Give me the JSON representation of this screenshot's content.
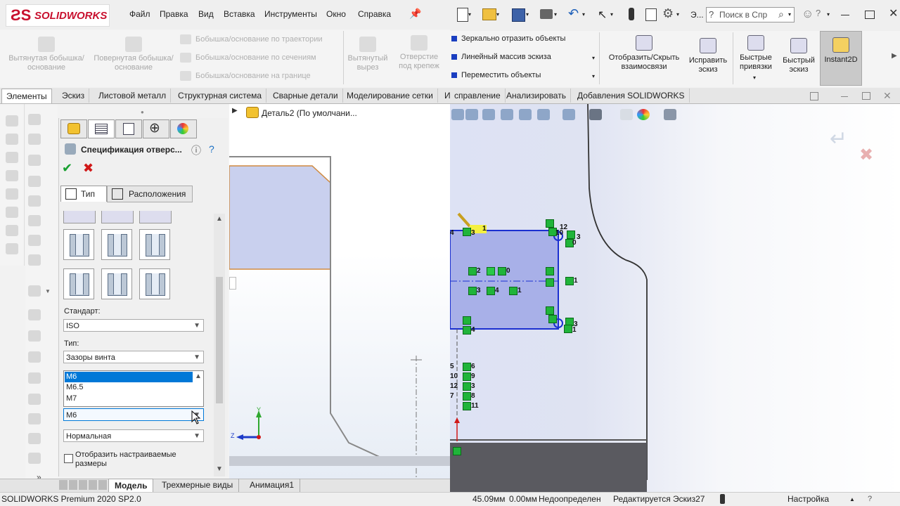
{
  "left": {
    "logo": "SOLIDWORKS",
    "menu": [
      "Файл",
      "Правка",
      "Вид",
      "Вставка",
      "Инструменты",
      "Окно",
      "Справка"
    ],
    "ribbon": {
      "extrude": "Вытянутая бобышка/основание",
      "revolve": "Повернутая бобышка/основание",
      "sweep": "Бобышка/основание по траектории",
      "loft": "Бобышка/основание по сечениям",
      "boundary": "Бобышка/основание на границе",
      "cut": "Вытянутый вырез",
      "hole": "Отверстие под крепеж"
    },
    "tabs": [
      "Элементы",
      "Эскиз",
      "Листовой металл",
      "Структурная система",
      "Сварные детали",
      "Моделирование сетки"
    ],
    "tab_partial": "Ис",
    "tree_item": "Деталь2  (По умолчани...",
    "pm": {
      "title": "Спецификация отверс...",
      "tab_type": "Тип",
      "tab_positions": "Расположения",
      "standard_label": "Стандарт:",
      "standard_value": "ISO",
      "type_label": "Тип:",
      "type_value": "Зазоры винта",
      "size_options": [
        "M6",
        "M6.5",
        "M7"
      ],
      "size_value": "M6",
      "fit_value": "Нормальная",
      "custom_sizes": "Отобразить настраиваемые размеры"
    },
    "bottom_tabs": [
      "Модель",
      "Трехмерные виды",
      "Анимация1"
    ],
    "status_version": "SOLIDWORKS Premium 2020 SP2.0",
    "triad_y": "Y",
    "triad_z": "Z"
  },
  "right": {
    "search_placeholder": "Поиск в Спр",
    "toolbar_partial": "Э...",
    "ribbon": {
      "mirror": "Зеркально отразить объекты",
      "linear": "Линейный массив эскиза",
      "move": "Переместить объекты",
      "relations": "Отобразить/Скрыть взаимосвязи",
      "repair": "Исправить эскиз",
      "snaps": "Быстрые привязки",
      "quick": "Быстрый эскиз",
      "instant2d": "Instant2D"
    },
    "tabs": [
      "справление",
      "Анализировать",
      "Добавления SOLIDWORKS"
    ],
    "status": {
      "coord_x": "45.09мм",
      "coord_y": "0.00мм",
      "state": "Недоопределен",
      "editing": "Редактируется Эскиз27",
      "units": "Настройка"
    },
    "relation_labels": {
      "r1": "1",
      "r2": "12",
      "r3": "10",
      "r4": "3",
      "r5": "0",
      "r6": "2",
      "r7": "0",
      "r8": "3",
      "r9": "4",
      "r10": "1",
      "r11": "1",
      "r12": "1",
      "r13": "3",
      "r14": "4",
      "r15": "1",
      "r16": "4",
      "r17": "3",
      "r18": "5",
      "r19": "6",
      "r20": "10",
      "r21": "9",
      "r22": "12",
      "r23": "3",
      "r24": "7",
      "r25": "8",
      "r26": "11",
      "r27": "4",
      "r28": "3"
    }
  },
  "colors": {
    "sketch_blue": "#1a2fd0",
    "sketch_fill": "#a8b0e8",
    "relation_green": "#20b43a",
    "edge_orange": "#d08a40",
    "select_blue": "#0078d7"
  }
}
